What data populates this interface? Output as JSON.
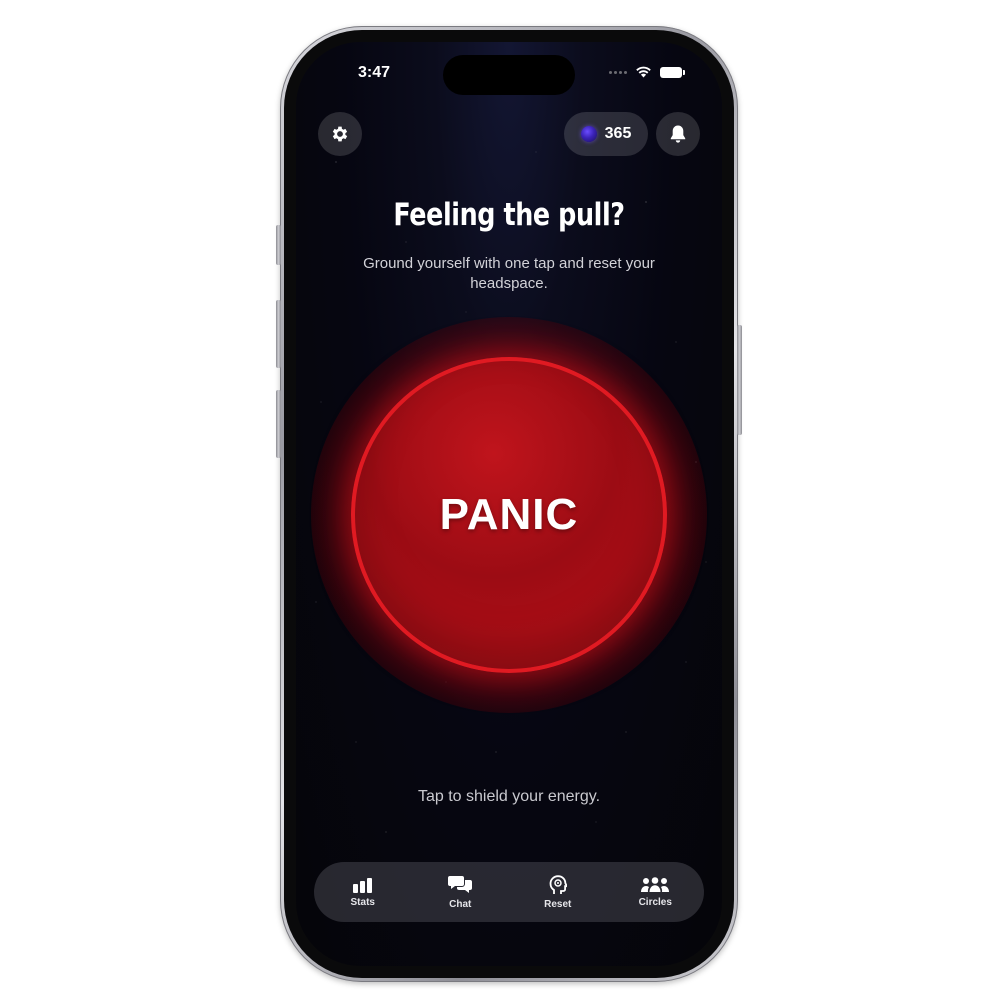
{
  "status_bar": {
    "time": "3:47"
  },
  "header": {
    "points": "365"
  },
  "main": {
    "headline": "Feeling the pull?",
    "subtext": "Ground yourself with one tap and reset your headspace.",
    "panic_label": "PANIC",
    "tap_hint": "Tap to shield your energy."
  },
  "tab_bar": {
    "items": [
      {
        "label": "Stats",
        "icon": "bar-chart-icon"
      },
      {
        "label": "Chat",
        "icon": "chat-bubbles-icon"
      },
      {
        "label": "Reset",
        "icon": "head-icon"
      },
      {
        "label": "Circles",
        "icon": "people-group-icon"
      }
    ]
  },
  "colors": {
    "panic_red": "#b20f17",
    "panic_border": "#e01a22",
    "background": "#050509"
  }
}
